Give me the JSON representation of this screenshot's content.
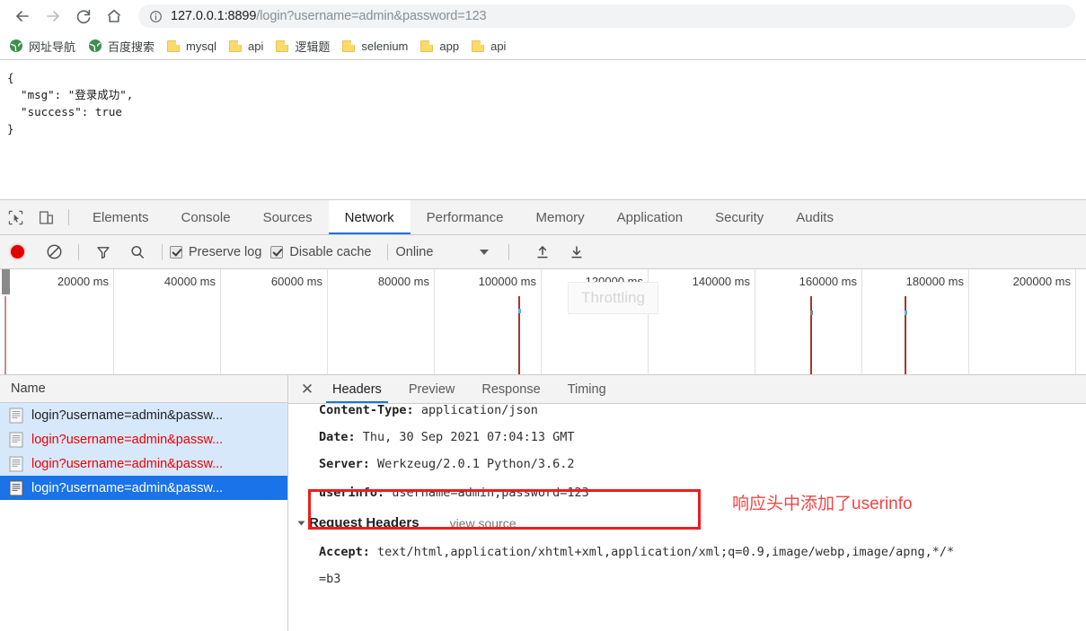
{
  "browser": {
    "nav": {
      "back_label": "Back",
      "forward_label": "Forward",
      "reload_label": "Reload",
      "home_label": "Home"
    },
    "omnibox": {
      "info_icon": "info-circle-icon",
      "host": "127.0.0.1:8899",
      "path": "/login?username=admin&password=123",
      "full_url": "127.0.0.1:8899/login?username=admin&password=123"
    },
    "bookmarks": [
      {
        "label": "网址导航",
        "icon": "globe-icon"
      },
      {
        "label": "百度搜索",
        "icon": "globe-icon"
      },
      {
        "label": "mysql",
        "icon": "folder-icon"
      },
      {
        "label": "api",
        "icon": "folder-icon"
      },
      {
        "label": "逻辑题",
        "icon": "folder-icon"
      },
      {
        "label": "selenium",
        "icon": "folder-icon"
      },
      {
        "label": "app",
        "icon": "folder-icon"
      },
      {
        "label": "api",
        "icon": "folder-icon"
      }
    ]
  },
  "page_content": {
    "body_text": "{\n  \"msg\": \"登录成功\",\n  \"success\": true\n}"
  },
  "devtools": {
    "tools": {
      "inspect_icon": "cursor-select-icon",
      "device_icon": "device-toolbar-icon"
    },
    "tabs": [
      {
        "label": "Elements",
        "active": false
      },
      {
        "label": "Console",
        "active": false
      },
      {
        "label": "Sources",
        "active": false
      },
      {
        "label": "Network",
        "active": true
      },
      {
        "label": "Performance",
        "active": false
      },
      {
        "label": "Memory",
        "active": false
      },
      {
        "label": "Application",
        "active": false
      },
      {
        "label": "Security",
        "active": false
      },
      {
        "label": "Audits",
        "active": false
      }
    ],
    "network_toolbar": {
      "record_icon": "record-circle-icon",
      "clear_icon": "clear-prohibited-icon",
      "filter_icon": "filter-funnel-icon",
      "search_icon": "search-magnifier-icon",
      "preserve_log": {
        "label": "Preserve log",
        "checked": true
      },
      "disable_cache": {
        "label": "Disable cache",
        "checked": true
      },
      "throttling": {
        "value": "Online",
        "caret_icon": "chevron-down-icon"
      },
      "import_icon": "import-arrow-up-icon",
      "export_icon": "export-arrow-down-icon"
    },
    "overview": {
      "tick_labels": [
        "20000 ms",
        "40000 ms",
        "60000 ms",
        "80000 ms",
        "100000 ms",
        "120000 ms",
        "140000 ms",
        "160000 ms",
        "180000 ms",
        "200000 ms"
      ],
      "tooltip": "Throttling"
    },
    "requests": {
      "column_header": "Name",
      "rows": [
        {
          "name": "login?username=admin&passw...",
          "state": "normal"
        },
        {
          "name": "login?username=admin&passw...",
          "state": "error"
        },
        {
          "name": "login?username=admin&passw...",
          "state": "error"
        },
        {
          "name": "login?username=admin&passw...",
          "state": "selected"
        }
      ]
    },
    "detail": {
      "close_icon": "close-x-icon",
      "tabs": [
        {
          "label": "Headers",
          "active": true
        },
        {
          "label": "Preview",
          "active": false
        },
        {
          "label": "Response",
          "active": false
        },
        {
          "label": "Timing",
          "active": false
        }
      ],
      "response_headers": [
        {
          "key": "Content-Type:",
          "value": "application/json"
        },
        {
          "key": "Date:",
          "value": "Thu, 30 Sep 2021 07:04:13 GMT"
        },
        {
          "key": "Server:",
          "value": "Werkzeug/2.0.1 Python/3.6.2"
        },
        {
          "key": "userinfo:",
          "value": "username=admin;password=123"
        }
      ],
      "request_headers_section": {
        "title": "Request Headers",
        "view_source": "view source",
        "expand_icon": "triangle-down-icon"
      },
      "request_headers": [
        {
          "key": "Accept:",
          "value": "text/html,application/xhtml+xml,application/xml;q=0.9,image/webp,image/apng,*/*"
        },
        {
          "key": "",
          "value": "=b3"
        }
      ]
    }
  },
  "annotations": {
    "highlight_box_color": "#f01c1c",
    "note_text": "响应头中添加了userinfo",
    "note_color": "#f04545"
  },
  "colors": {
    "accent_blue": "#1a73e8",
    "selected_row_bg": "#1a73e8",
    "error_text": "#ee0000",
    "record_red": "#e10000",
    "folder_yellow": "#fbd96b"
  }
}
